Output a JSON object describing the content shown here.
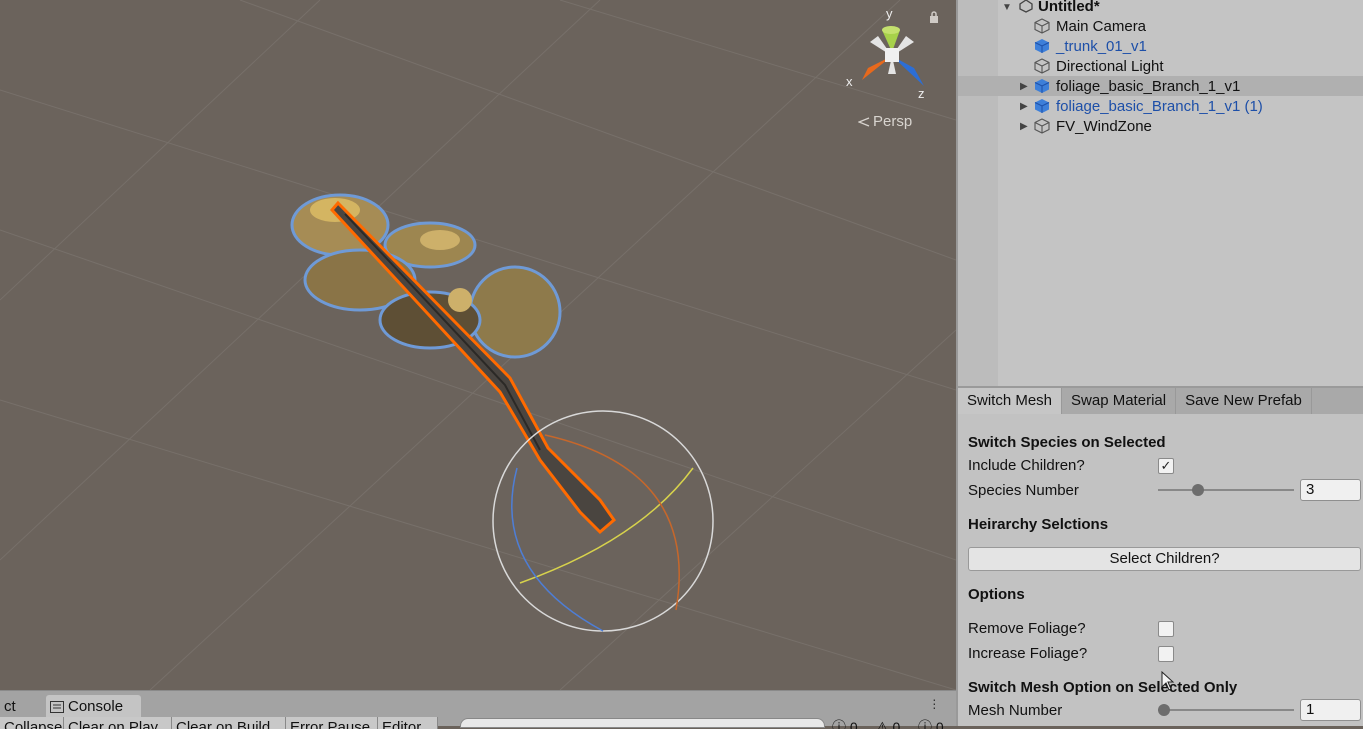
{
  "scene_view": {
    "gizmo_axes": {
      "x": "x",
      "y": "y",
      "z": "z"
    },
    "projection_label": "Persp",
    "icons": [
      "lock-icon",
      "persp-icon"
    ]
  },
  "hierarchy": {
    "scene_name": "Untitled*",
    "items": [
      {
        "label": "Main Camera",
        "prefab": false,
        "expandable": false,
        "selected": false
      },
      {
        "label": "_trunk_01_v1",
        "prefab": true,
        "expandable": false,
        "selected": false
      },
      {
        "label": "Directional Light",
        "prefab": false,
        "expandable": false,
        "selected": false
      },
      {
        "label": "foliage_basic_Branch_1_v1",
        "prefab": true,
        "expandable": true,
        "selected": true
      },
      {
        "label": "foliage_basic_Branch_1_v1 (1)",
        "prefab": true,
        "expandable": true,
        "selected": false
      },
      {
        "label": "FV_WindZone",
        "prefab": false,
        "expandable": true,
        "selected": false
      }
    ]
  },
  "inspector": {
    "tabs": [
      "Switch Mesh",
      "Swap Material",
      "Save New Prefab"
    ],
    "active_tab": "Switch Mesh",
    "switch_species_title": "Switch Species on Selected",
    "include_children_label": "Include Children?",
    "include_children_checked": true,
    "check_mark": "✓",
    "species_number_label": "Species Number",
    "species_number_value": "3",
    "heirarchy_title": "Heirarchy Selctions",
    "select_children_label": "Select Children?",
    "options_title": "Options",
    "remove_foliage_label": "Remove Foliage?",
    "remove_foliage_checked": false,
    "increase_foliage_label": "Increase Foliage?",
    "increase_foliage_checked": false,
    "switch_mesh_title": "Switch Mesh Option on Selected Only",
    "mesh_number_label": "Mesh Number",
    "mesh_number_value": "1"
  },
  "bottom_panel": {
    "tabs": [
      "ct",
      "Console"
    ],
    "console_buttons": [
      "Collapse",
      "Clear on Play",
      "Clear on Build",
      "Error Pause",
      "Editor"
    ],
    "counters": [
      "0",
      "0",
      "0"
    ]
  },
  "colors": {
    "scene_bg": "#6b635c",
    "selection_outline": "#ff6a00",
    "prefab_text": "#1d4fa8",
    "axis_x": "#e8691c",
    "axis_y": "#a7d14a",
    "axis_z": "#2c6ed6"
  }
}
